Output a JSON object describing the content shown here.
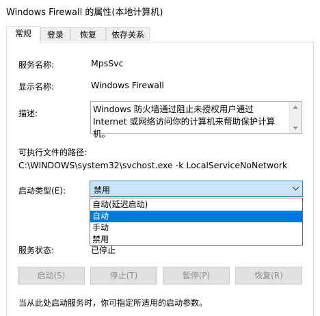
{
  "window": {
    "title": "Windows Firewall 的属性(本地计算机)"
  },
  "tabs": [
    {
      "label": "常规",
      "active": true
    },
    {
      "label": "登录",
      "active": false
    },
    {
      "label": "恢复",
      "active": false
    },
    {
      "label": "依存关系",
      "active": false
    }
  ],
  "general": {
    "service_name_label": "服务名称:",
    "service_name_value": "MpsSvc",
    "display_name_label": "显示名称:",
    "display_name_value": "Windows Firewall",
    "description_label": "描述:",
    "description_value": "Windows 防火墙通过阻止未授权用户通过 Internet 或网络访问你的计算机来帮助保护计算机。",
    "exe_path_label": "可执行文件的路径:",
    "exe_path_value": "C:\\WINDOWS\\system32\\svchost.exe -k LocalServiceNoNetwork",
    "startup_type_label": "启动类型(E):",
    "startup_type_value": "禁用",
    "startup_options": [
      "自动(延迟启动)",
      "自动",
      "手动",
      "禁用"
    ],
    "startup_highlighted": "自动",
    "service_status_label": "服务状态:",
    "service_status_value": "已停止",
    "buttons": {
      "start": "启动(S)",
      "stop": "停止(T)",
      "pause": "暂停(P)",
      "resume": "恢复(R)"
    },
    "hint": "当从此处启动服务时，你可指定所适用的启动参数。"
  },
  "colors": {
    "accent": "#0078d7",
    "combo_bg": "#cce4f7",
    "combo_border": "#3c7fb1",
    "disabled_text": "#8d8d8d"
  },
  "icons": {
    "combo": "chevron-down-icon",
    "scroll_up": "arrow-up-icon",
    "scroll_down": "arrow-down-icon"
  }
}
